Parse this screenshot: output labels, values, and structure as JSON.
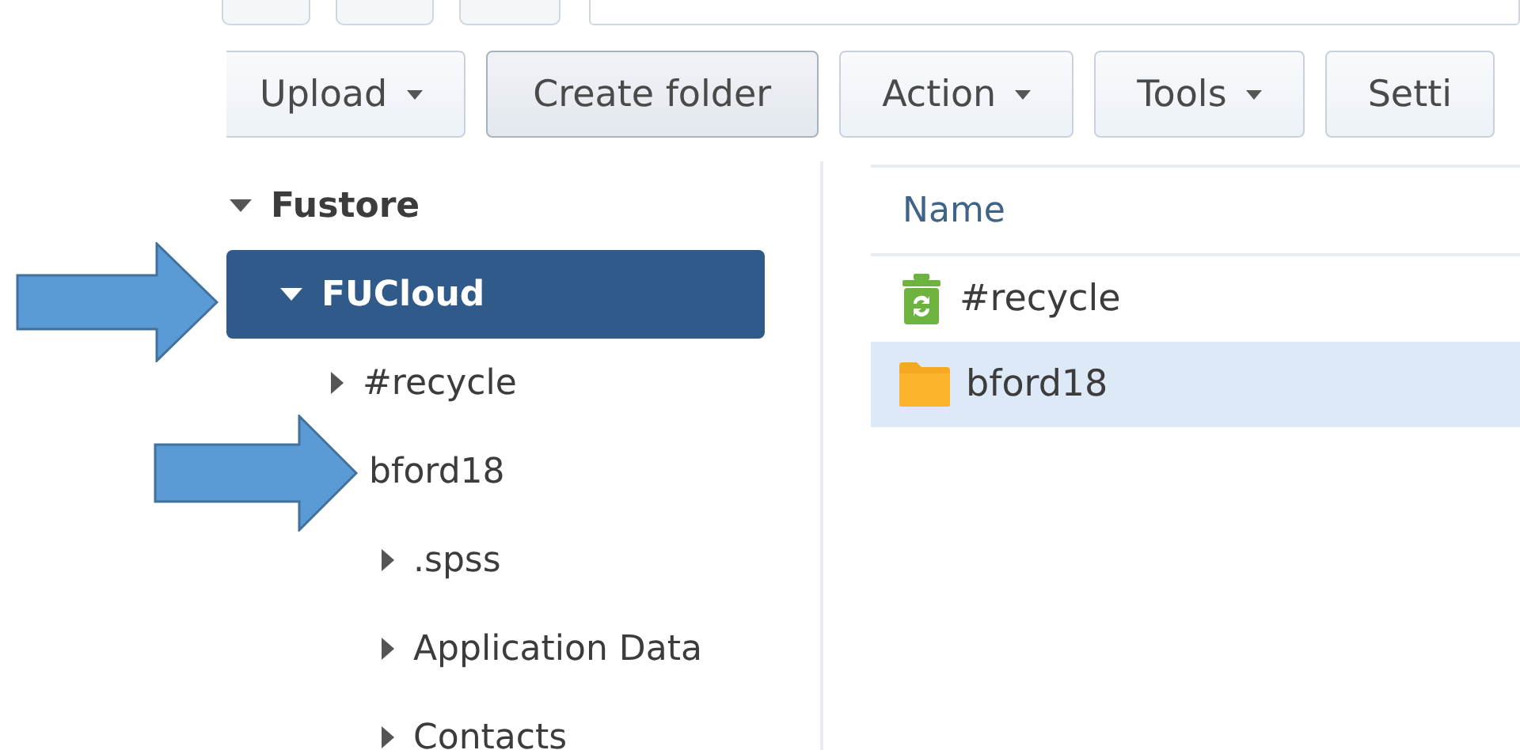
{
  "toolbar": [
    {
      "label": "Upload",
      "dropdown": true
    },
    {
      "label": "Create folder",
      "dropdown": false
    },
    {
      "label": "Action",
      "dropdown": true
    },
    {
      "label": "Tools",
      "dropdown": true
    },
    {
      "label": "Setti",
      "dropdown": false
    }
  ],
  "tree": [
    {
      "label": "Fustore",
      "bold": true,
      "expanded": true,
      "selected": false,
      "children": [
        {
          "label": "FUCloud",
          "bold": true,
          "expanded": true,
          "selected": true,
          "children": [
            {
              "label": "#recycle",
              "bold": false,
              "expanded": false,
              "selected": false
            },
            {
              "label": "bford18",
              "bold": false,
              "selected": false,
              "children": [
                {
                  "label": ".spss",
                  "bold": false,
                  "expanded": false,
                  "selected": false
                },
                {
                  "label": "Application Data",
                  "bold": false,
                  "expanded": false,
                  "selected": false
                },
                {
                  "label": "Contacts",
                  "bold": false,
                  "expanded": false,
                  "selected": false
                }
              ]
            }
          ]
        }
      ]
    }
  ],
  "file_list": {
    "columns": [
      "Name"
    ],
    "rows": [
      {
        "name": "#recycle",
        "kind": "recycle",
        "selected": false
      },
      {
        "name": "bford18",
        "kind": "folder",
        "selected": true
      }
    ]
  }
}
